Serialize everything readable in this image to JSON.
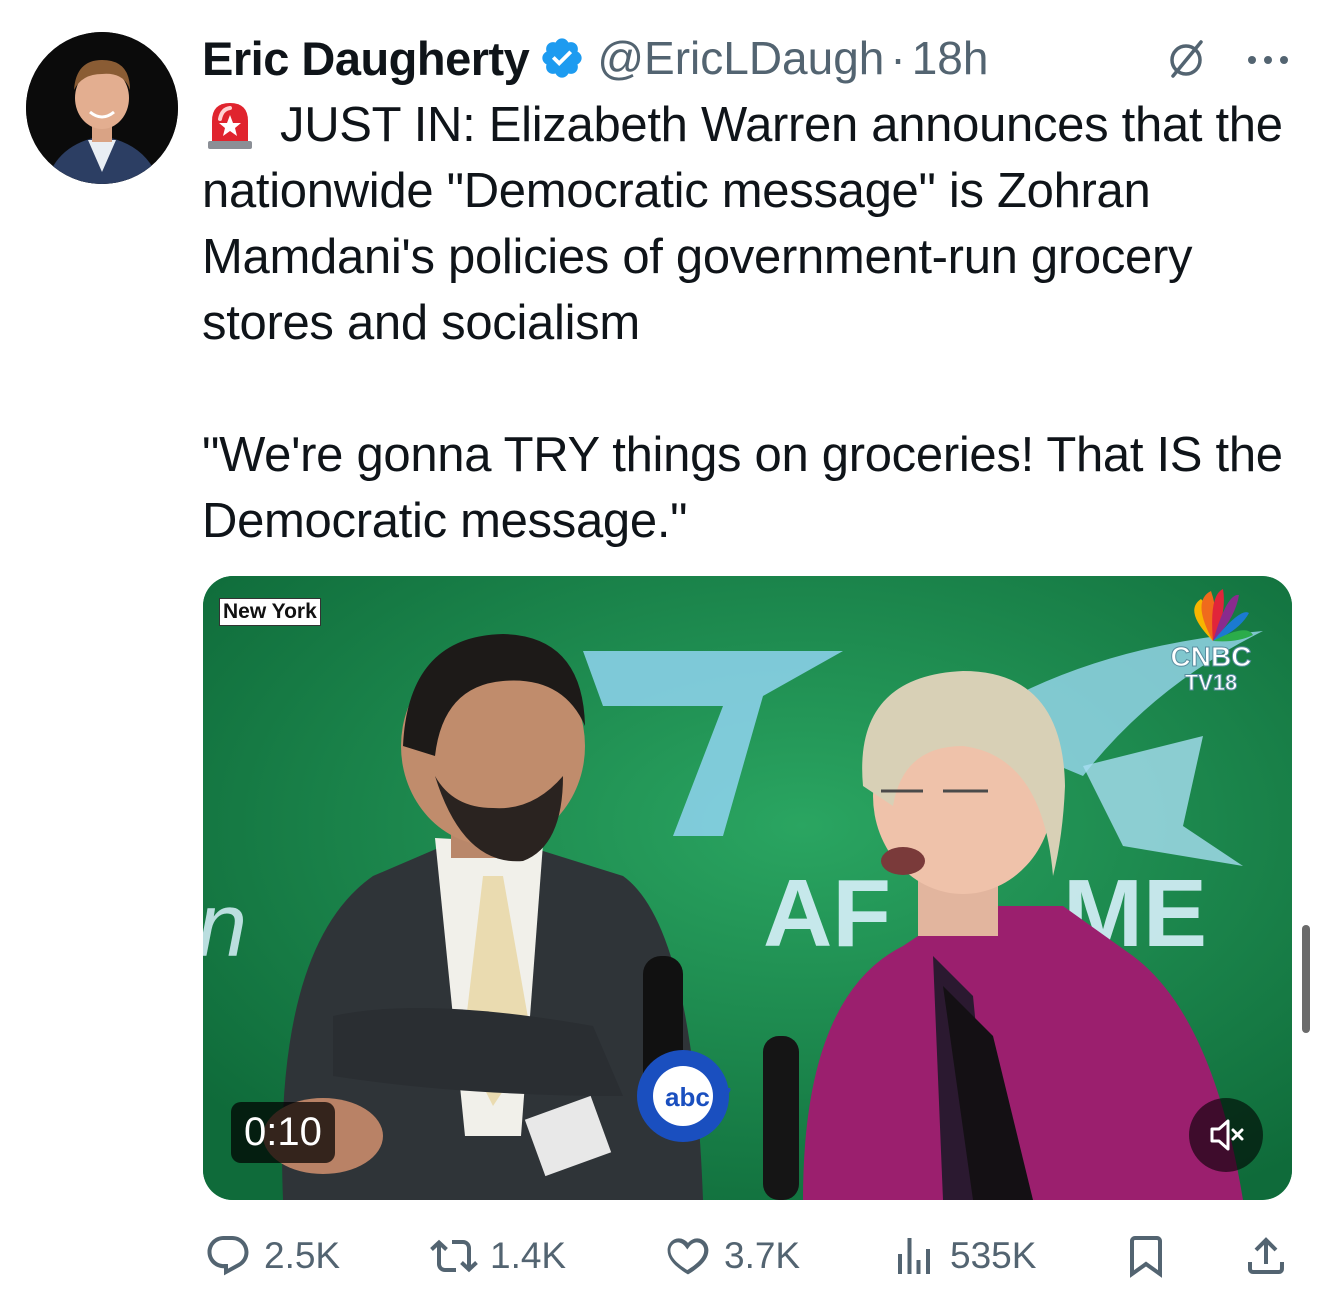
{
  "author": {
    "name": "Eric Daugherty",
    "handle": "@EricLDaugh",
    "separator": "·",
    "time": "18h"
  },
  "tweet": {
    "line1": "JUST IN: Elizabeth Warren announces that the nationwide \"Democratic message\" is Zohran Mamdani's policies of government-run grocery stores and socialism",
    "line2": "\"We're gonna TRY things on groceries! That IS the Democratic message.\""
  },
  "media": {
    "location_tag": "New York",
    "duration": "0:10",
    "channel_logo": "CNBC TV18",
    "channel_logo_line1": "CNBC",
    "channel_logo_line2": "TV18",
    "mic_logo": "abc 7"
  },
  "actions": {
    "replies": "2.5K",
    "reposts": "1.4K",
    "likes": "3.7K",
    "views": "535K"
  },
  "icons": [
    "verified-badge-icon",
    "grok-icon",
    "more-icon",
    "siren-emoji-icon",
    "mute-icon",
    "reply-icon",
    "repost-icon",
    "like-icon",
    "views-icon",
    "bookmark-icon",
    "share-icon"
  ],
  "colors": {
    "text": "#0f1419",
    "secondary": "#536471",
    "verified": "#1d9bf0",
    "video_background": "#16834a"
  }
}
